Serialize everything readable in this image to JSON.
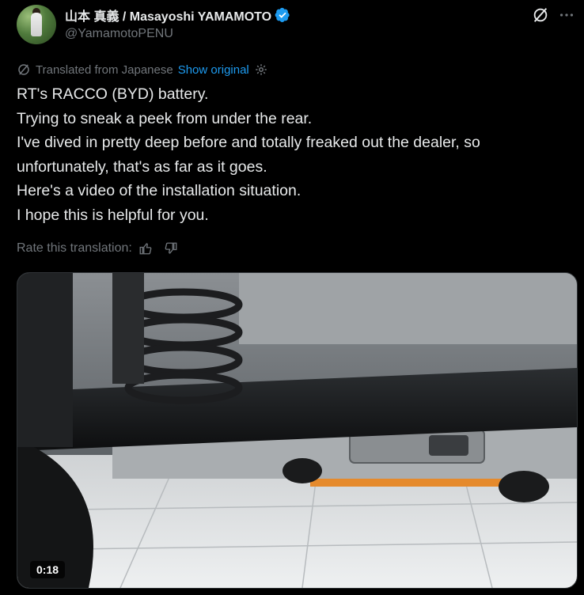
{
  "author": {
    "display_name": "山本 真義 / Masayoshi YAMAMOTO",
    "handle": "@YamamotoPENU",
    "verified": true
  },
  "translation": {
    "label": "Translated from Japanese",
    "show_original": "Show original"
  },
  "tweet": {
    "lines": [
      "RT's RACCO (BYD) battery.",
      "Trying to sneak a peek from under the rear.",
      "I've dived in pretty deep before and totally freaked out the dealer, so",
      "unfortunately, that's as far as it goes.",
      "Here's a video of the installation situation.",
      "I hope this is helpful for you."
    ]
  },
  "rate": {
    "label": "Rate this translation:"
  },
  "media": {
    "duration": "0:18"
  },
  "icons": {
    "verified": "verified-badge-icon",
    "grok": "grok-icon",
    "more": "more-icon",
    "translate": "translate-icon",
    "settings": "settings-icon",
    "thumbs_up": "thumbs-up-icon",
    "thumbs_down": "thumbs-down-icon"
  },
  "colors": {
    "background": "#000000",
    "text": "#e7e9ea",
    "muted": "#71767b",
    "link": "#1d9bf0"
  }
}
